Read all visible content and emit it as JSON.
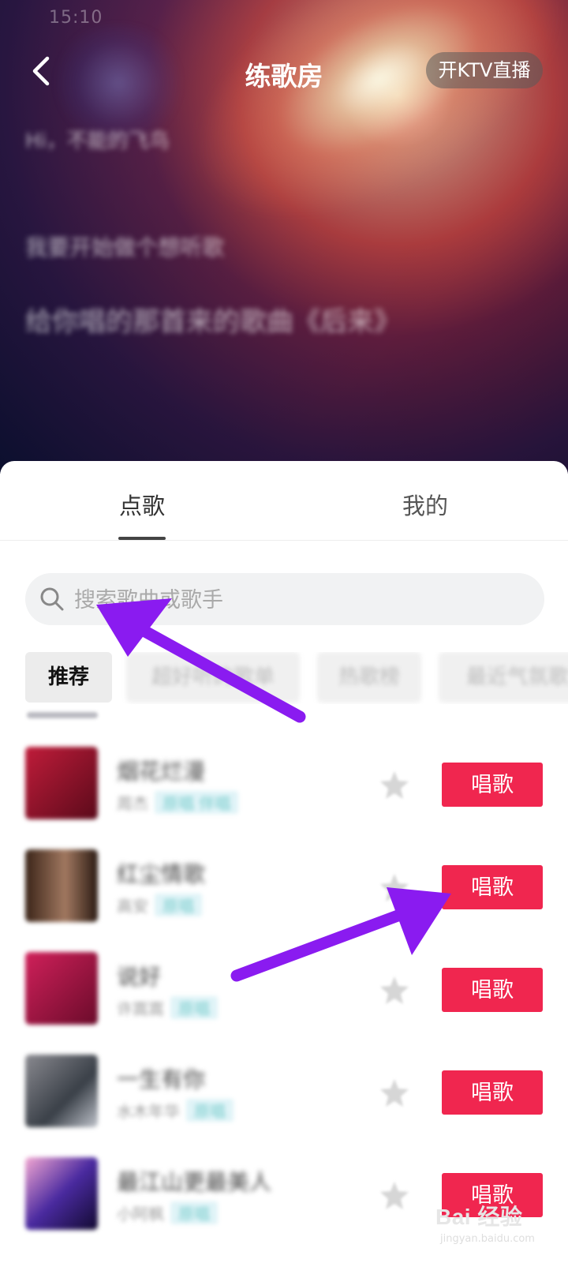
{
  "status_bar": {
    "time": "15:10"
  },
  "header": {
    "title": "练歌房",
    "ktv_button_label": "开KTV直播",
    "blurred_lines": [
      "Hi，不能的飞鸟",
      "我要开始做个想听歌",
      "给你唱的那首来的歌曲《后来》"
    ]
  },
  "tabs": [
    {
      "label": "点歌",
      "active": true
    },
    {
      "label": "我的",
      "active": false
    }
  ],
  "search": {
    "placeholder": "搜索歌曲或歌手",
    "value": ""
  },
  "categories": [
    "推荐",
    "超好听的歌单",
    "热歌榜",
    "最近气氛歌"
  ],
  "songs": [
    {
      "title": "烟花烂漫",
      "subtitle": "周杰",
      "tag": "原唱 伴唱",
      "sing_label": "唱歌",
      "cover_color": "#9a1b35"
    },
    {
      "title": "红尘情歌",
      "subtitle": "高安",
      "tag": "原唱",
      "sing_label": "唱歌",
      "cover_color": "#5a3a2a"
    },
    {
      "title": "说好",
      "subtitle": "许嵩嵩",
      "tag": "原唱",
      "sing_label": "唱歌",
      "cover_color": "#b01c4a"
    },
    {
      "title": "一生有你",
      "subtitle": "水木年华",
      "tag": "原唱",
      "sing_label": "唱歌",
      "cover_color": "#6c6f78"
    },
    {
      "title": "最江山更最美人",
      "subtitle": "小阿枫",
      "tag": "原唱",
      "sing_label": "唱歌",
      "cover_color": "#3b2a6a"
    }
  ],
  "watermark": {
    "brand": "Bai 经验",
    "url": "jingyan.baidu.com"
  },
  "colors": {
    "accent": "#f0264f",
    "annotation_arrow": "#8a1bf0"
  }
}
